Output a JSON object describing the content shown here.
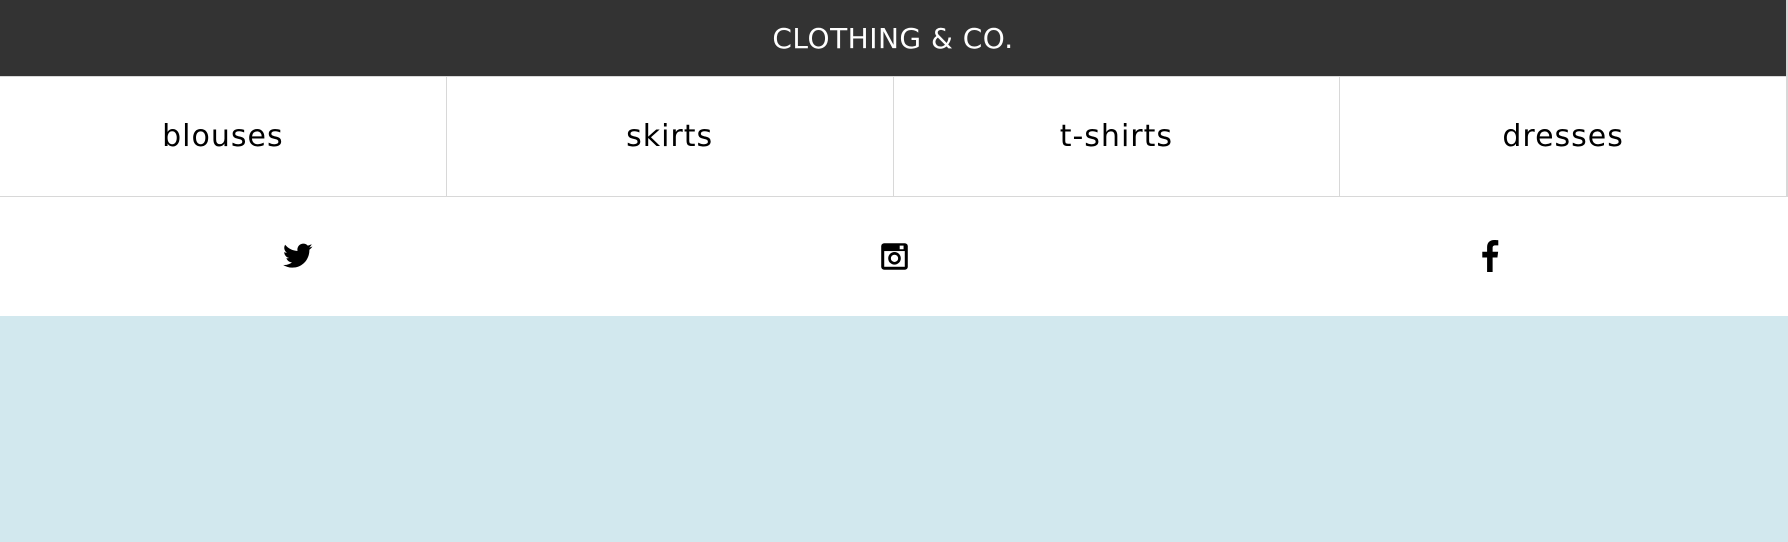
{
  "header": {
    "title": "CLOTHING & CO."
  },
  "categories": [
    {
      "label": "blouses"
    },
    {
      "label": "skirts"
    },
    {
      "label": "t-shirts"
    },
    {
      "label": "dresses"
    }
  ],
  "social": [
    {
      "icon": "twitter-icon"
    },
    {
      "icon": "instagram-icon"
    },
    {
      "icon": "facebook-icon"
    }
  ],
  "colors": {
    "header_bg": "#333333",
    "header_text": "#ffffff",
    "hero_bg": "#d2e8ee",
    "divider": "#d8d8d8"
  }
}
